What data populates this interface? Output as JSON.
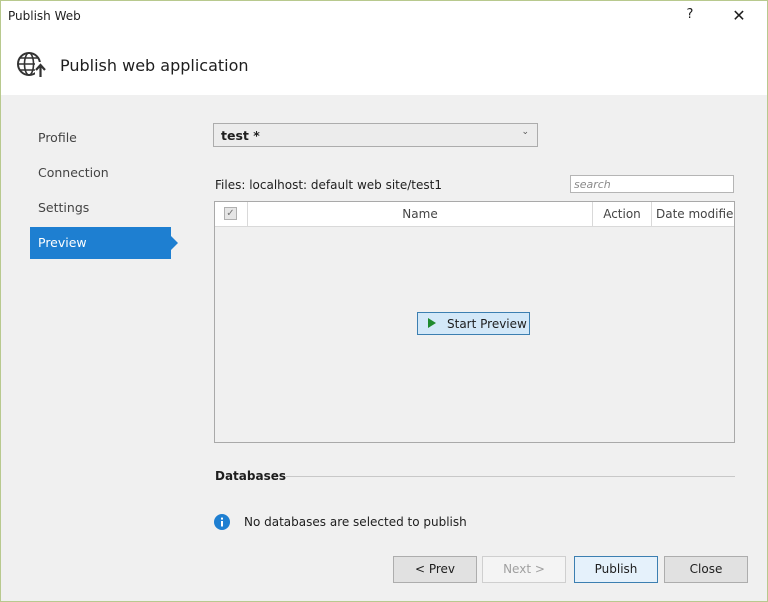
{
  "window": {
    "title": "Publish Web",
    "help": "?",
    "close": "✕"
  },
  "header": {
    "title": "Publish web application",
    "icon": "globe-publish-icon"
  },
  "sidebar": {
    "items": [
      {
        "label": "Profile",
        "active": false
      },
      {
        "label": "Connection",
        "active": false
      },
      {
        "label": "Settings",
        "active": false
      },
      {
        "label": "Preview",
        "active": true
      }
    ]
  },
  "profile": {
    "selected": "test *"
  },
  "files": {
    "label": "Files:  localhost: default web site/test1",
    "search_placeholder": "search",
    "columns": {
      "name": "Name",
      "action": "Action",
      "date": "Date modifie"
    },
    "start_preview_label": "Start Preview"
  },
  "databases": {
    "title": "Databases",
    "message": "No databases are selected to publish"
  },
  "buttons": {
    "prev": "< Prev",
    "next": "Next >",
    "publish": "Publish",
    "close": "Close"
  },
  "colors": {
    "accent": "#1e7fd1",
    "play": "#1e8a2e",
    "info": "#1e7fd1"
  }
}
